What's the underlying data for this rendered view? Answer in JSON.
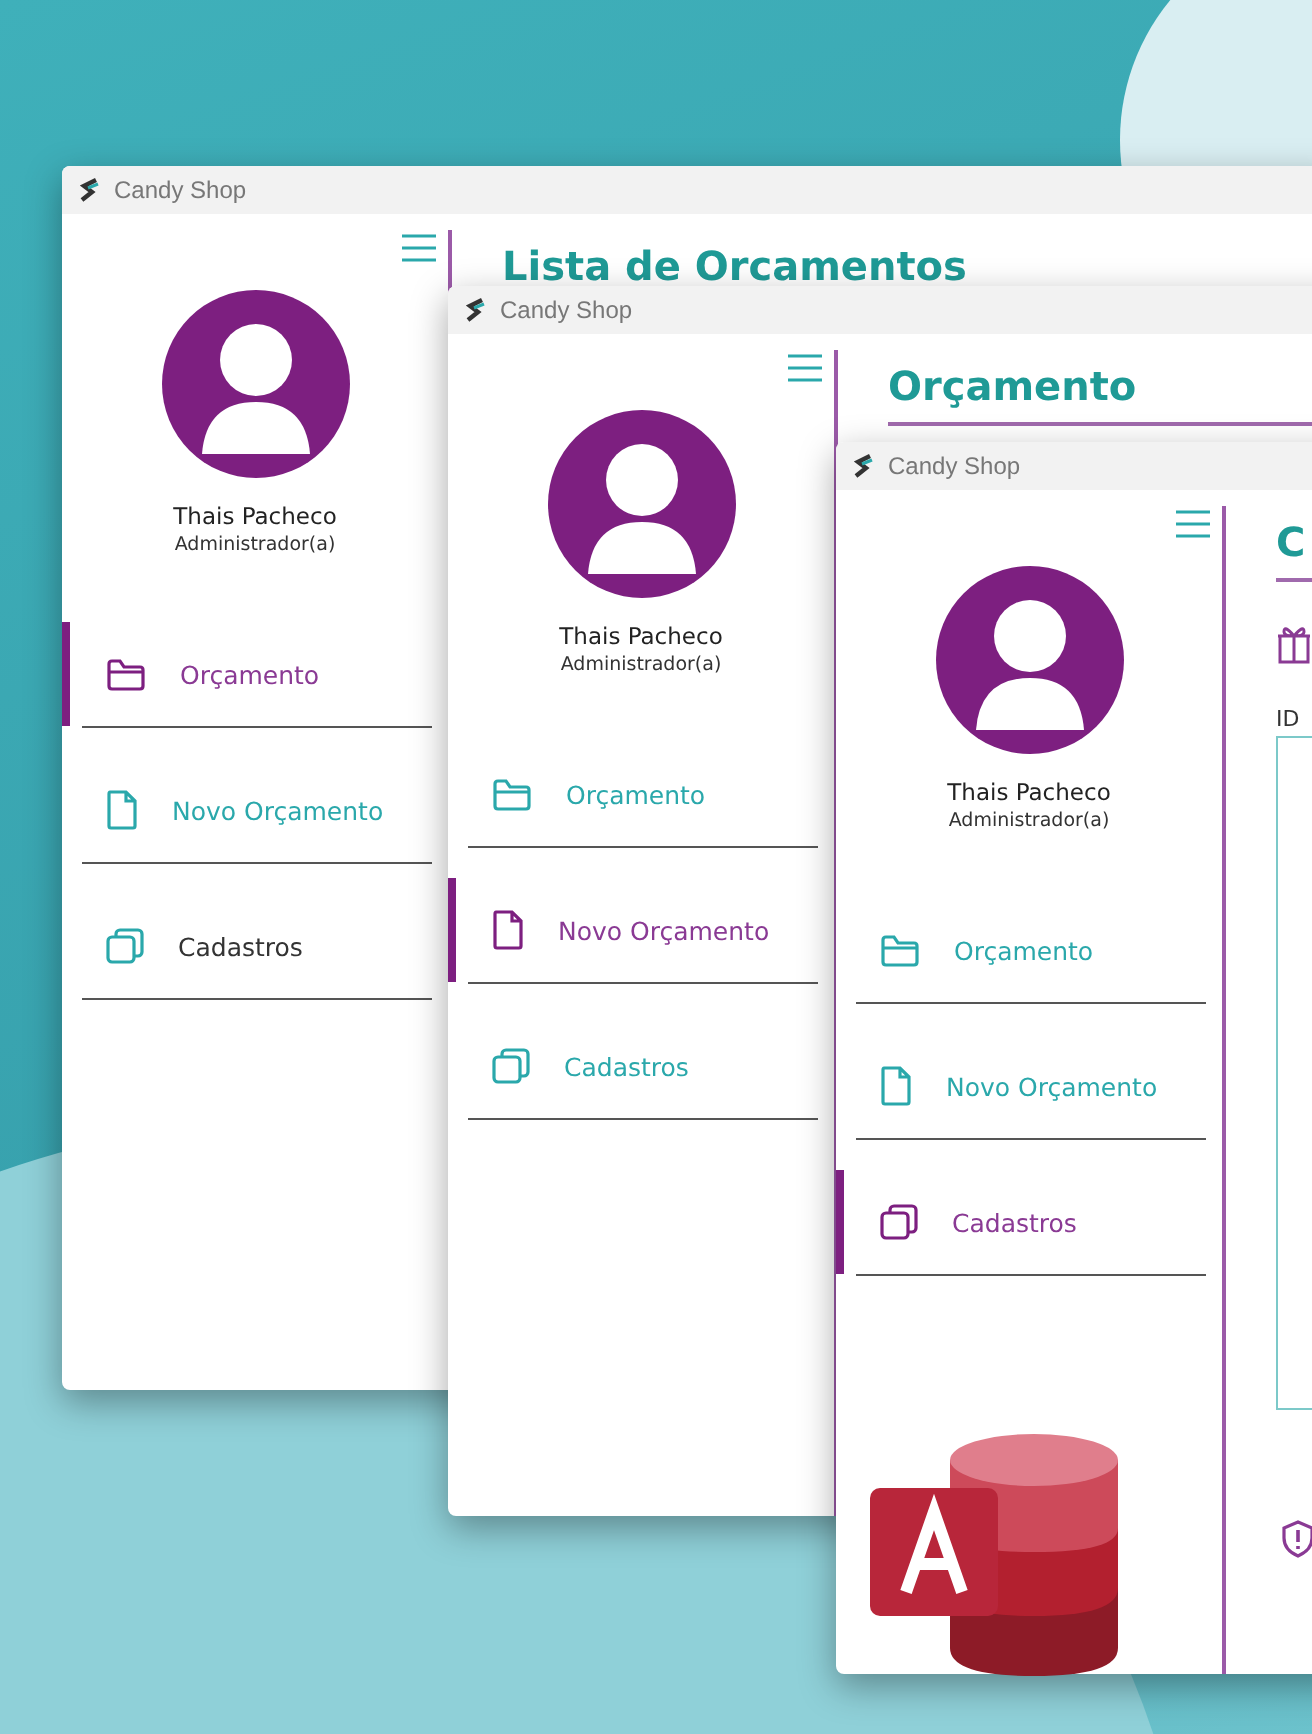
{
  "windows": [
    {
      "title": "Candy Shop",
      "user": {
        "name": "Thais Pacheco",
        "role": "Administrador(a)"
      },
      "nav": [
        {
          "label": "Orçamento",
          "selected": true,
          "color": "#8a3a94"
        },
        {
          "label": "Novo Orçamento",
          "selected": false,
          "color": "#2aa8ab"
        },
        {
          "label": "Cadastros",
          "selected": false,
          "color": "#333333"
        }
      ],
      "main": {
        "heading": "Lista de Orcamentos"
      }
    },
    {
      "title": "Candy Shop",
      "user": {
        "name": "Thais Pacheco",
        "role": "Administrador(a)"
      },
      "nav": [
        {
          "label": "Orçamento",
          "selected": false,
          "color": "#2aa8ab"
        },
        {
          "label": "Novo Orçamento",
          "selected": true,
          "color": "#8a3a94"
        },
        {
          "label": "Cadastros",
          "selected": false,
          "color": "#2aa8ab"
        }
      ],
      "main": {
        "heading": "Orçamento"
      }
    },
    {
      "title": "Candy Shop",
      "user": {
        "name": "Thais Pacheco",
        "role": "Administrador(a)"
      },
      "nav": [
        {
          "label": "Orçamento",
          "selected": false,
          "color": "#2aa8ab"
        },
        {
          "label": "Novo Orçamento",
          "selected": false,
          "color": "#2aa8ab"
        },
        {
          "label": "Cadastros",
          "selected": true,
          "color": "#8a3a94"
        }
      ],
      "main": {
        "heading": "C",
        "field_label": "ID"
      }
    }
  ]
}
